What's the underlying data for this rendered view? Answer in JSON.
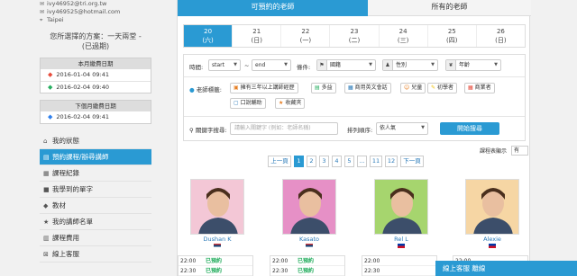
{
  "sidebar": {
    "contacts": [
      {
        "icon": "envelope-icon",
        "text": "ivy46952@tri.org.tw"
      },
      {
        "icon": "envelope-icon",
        "text": "ivy469525@hotmail.com"
      },
      {
        "icon": "location-pin-icon",
        "text": "Taipei"
      }
    ],
    "plan_line1": "您所選擇的方案：一天兩堂 -",
    "plan_line2": "(已過期)",
    "this_month": {
      "header": "本月繳費日期",
      "rows": [
        {
          "tag": "◆",
          "tag_class": "tag-red",
          "date": "2016-01-04 09:41"
        },
        {
          "tag": "◆",
          "tag_class": "tag-green",
          "date": "2016-02-04 09:40"
        }
      ]
    },
    "next_month": {
      "header": "下個月繳費日期",
      "rows": [
        {
          "tag": "◆",
          "tag_class": "tag-blue",
          "date": "2016-02-04 09:41"
        }
      ]
    },
    "nav": [
      {
        "icon": "home-icon",
        "glyph": "⌂",
        "label": "我的狀態"
      },
      {
        "icon": "calendar-icon",
        "glyph": "▤",
        "label": "預約課程/辦尋講師",
        "active": true
      },
      {
        "icon": "record-icon",
        "glyph": "▦",
        "label": "課程紀錄"
      },
      {
        "icon": "book-icon",
        "glyph": "■",
        "label": "我學到的單字"
      },
      {
        "icon": "material-icon",
        "glyph": "◆",
        "label": "教材"
      },
      {
        "icon": "star-icon",
        "glyph": "★",
        "label": "我的講師名單"
      },
      {
        "icon": "cart-icon",
        "glyph": "▥",
        "label": "課程費用"
      },
      {
        "icon": "logout-icon",
        "glyph": "⊠",
        "label": "線上客服"
      }
    ]
  },
  "main": {
    "tabs": {
      "available": "可預約的老師",
      "all": "所有的老師"
    },
    "days": [
      {
        "num": "20",
        "dow": "(六)",
        "selected": true
      },
      {
        "num": "21",
        "dow": "(日)"
      },
      {
        "num": "22",
        "dow": "(一)"
      },
      {
        "num": "23",
        "dow": "(二)"
      },
      {
        "num": "24",
        "dow": "(三)"
      },
      {
        "num": "25",
        "dow": "(四)"
      },
      {
        "num": "26",
        "dow": "(日)"
      }
    ],
    "filters": {
      "time_label": "時間:",
      "start": "start",
      "tilde": "~",
      "end": "end",
      "cond_label": "條件:",
      "country": "國籍",
      "gender": "性別",
      "age": "年齡",
      "features_label": "老師標籤:",
      "features": [
        {
          "icon": "medal-icon",
          "glyph": "▣",
          "label": "擁有三年以上講師經歷",
          "color": "#e67e22"
        },
        {
          "icon": "chart-icon",
          "glyph": "▤",
          "label": "多益",
          "color": "#27ae60"
        },
        {
          "icon": "business-icon",
          "glyph": "▦",
          "label": "商用英文會話",
          "color": "#2a7ab8"
        },
        {
          "icon": "child-icon",
          "glyph": "☺",
          "label": "兒童",
          "color": "#e67e22"
        },
        {
          "icon": "beginner-icon",
          "glyph": "✎",
          "label": "初學者",
          "color": "#f1c40f"
        },
        {
          "icon": "business-icon",
          "glyph": "▦",
          "label": "商業者",
          "color": "#e74c3c"
        },
        {
          "icon": "speech-icon",
          "glyph": "▢",
          "label": "口說輔助",
          "color": "#2a7ab8"
        },
        {
          "icon": "star-icon",
          "glyph": "★",
          "label": "收藏夾",
          "color": "#e67e22"
        }
      ],
      "keyword_label": "關鍵字搜尋:",
      "keyword_placeholder": "請輸入關鍵字 (例如：老師名稱)",
      "sort_label": "排列順序:",
      "sort_value": "依人氣",
      "search_button": "開始搜尋"
    },
    "sort_display_label": "課程表顯示",
    "sort_display_value": "有",
    "pager": {
      "prev": "上一頁",
      "pages": [
        "1",
        "2",
        "3",
        "4",
        "5",
        "...",
        "11",
        "12"
      ],
      "current": "1",
      "next": "下一頁"
    },
    "teachers": [
      {
        "name": "Dushan K",
        "flag": "serbia-flag-icon",
        "bg": "#f3c7d6"
      },
      {
        "name": "Kasato",
        "flag": "serbia-flag-icon",
        "bg": "#e690c6"
      },
      {
        "name": "Rel L",
        "flag": "philippines-flag-icon",
        "bg": "#a6d56e"
      },
      {
        "name": "Alexie",
        "flag": "philippines-flag-icon",
        "bg": "#f6d6a4"
      }
    ],
    "slots": [
      {
        "time": "22:00",
        "status": "已預約"
      },
      {
        "time": "22:30",
        "status": "已預約"
      }
    ]
  },
  "chat": {
    "label": "線上客服 離線"
  },
  "colors": {
    "accent": "#2a9ad3",
    "booked": "#27ae60",
    "link": "#2a7ab8"
  }
}
